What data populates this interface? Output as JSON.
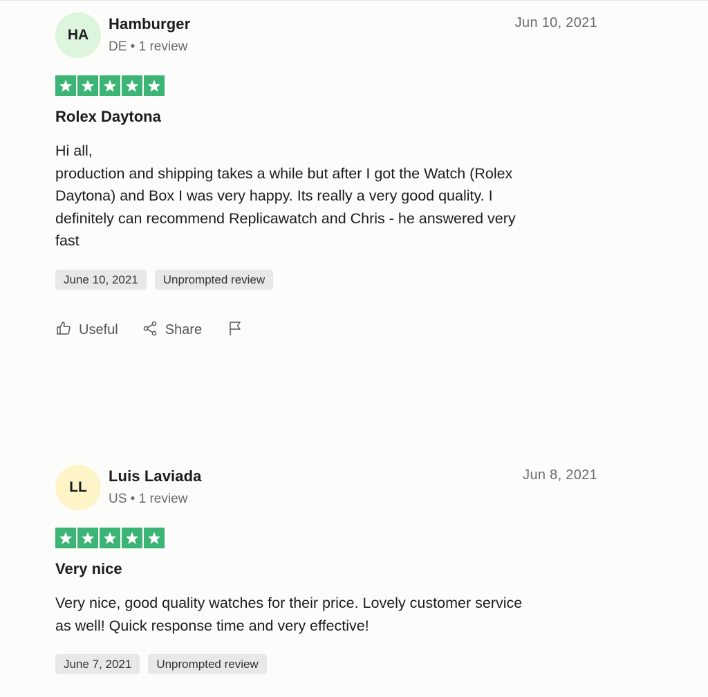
{
  "reviews": [
    {
      "avatar_initials": "HA",
      "avatar_color": "#dcf5dc",
      "name": "Hamburger",
      "meta": "DE • 1 review",
      "date": "Jun 10, 2021",
      "rating": 5,
      "title": "Rolex Daytona",
      "body_lines": [
        "Hi all,",
        "production and shipping takes a while but after I got the Watch (Rolex",
        "Daytona) and Box I was very happy. Its really a very good quality. I",
        "definitely can recommend Replicawatch and Chris - he answered very",
        "fast"
      ],
      "tags": [
        "June 10, 2021",
        "Unprompted review"
      ],
      "actions": {
        "useful": "Useful",
        "share": "Share"
      }
    },
    {
      "avatar_initials": "LL",
      "avatar_color": "#fdf5c8",
      "name": "Luis Laviada",
      "meta": "US • 1 review",
      "date": "Jun 8, 2021",
      "rating": 5,
      "title": "Very nice",
      "body_lines": [
        "Very nice, good quality watches for their price. Lovely customer service",
        "as well! Quick response time and very effective!"
      ],
      "tags": [
        "June 7, 2021",
        "Unprompted review"
      ]
    }
  ],
  "colors": {
    "star_green": "#3cb476",
    "tag_bg": "#e8e8e6",
    "muted_text": "#6b6b6b"
  },
  "icons": [
    "thumbs-up-icon",
    "share-icon",
    "flag-icon",
    "star-icon"
  ]
}
